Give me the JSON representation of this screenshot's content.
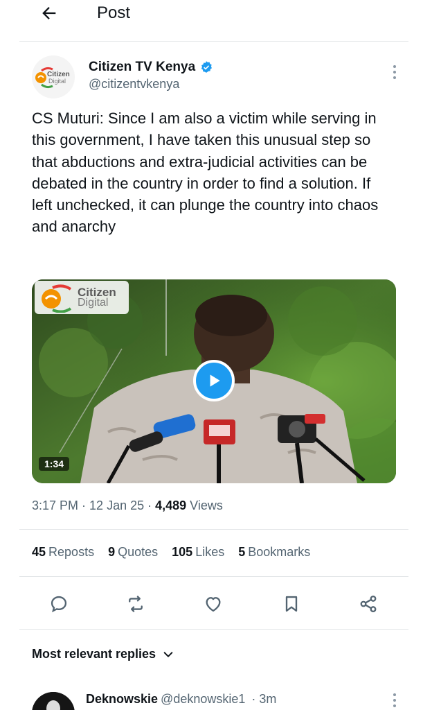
{
  "header": {
    "title": "Post"
  },
  "post": {
    "author_name": "Citizen TV Kenya",
    "author_handle": "@citizentvkenya",
    "avatar_text": "Citizen Digital",
    "text": "CS Muturi: Since I am also a victim while serving in this government, I have taken this unusual step so that abductions and extra-judicial activities can be debated in the country in order to find a solution. If left unchecked, it can plunge the country into chaos and anarchy",
    "media": {
      "logo_line1": "Citizen",
      "logo_line2": "Digital",
      "duration": "1:34"
    },
    "meta": {
      "time": "3:17 PM",
      "sep1": " · ",
      "date": "12 Jan 25",
      "sep2": " · ",
      "views_count": "4,489",
      "views_label": " Views"
    },
    "stats": {
      "reposts_count": "45",
      "reposts_label": "Reposts",
      "quotes_count": "9",
      "quotes_label": "Quotes",
      "likes_count": "105",
      "likes_label": "Likes",
      "bookmarks_count": "5",
      "bookmarks_label": "Bookmarks"
    }
  },
  "replies": {
    "header": "Most relevant replies",
    "first": {
      "name": "Deknowskie",
      "handle": "@deknowskie1",
      "time": "· 3m"
    }
  },
  "colors": {
    "accent": "#1d9bf0",
    "text": "#0f1419",
    "secondary": "#536471",
    "logo_orange": "#f39200"
  }
}
